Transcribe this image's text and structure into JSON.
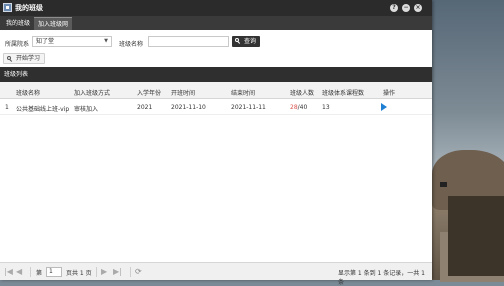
{
  "window": {
    "title": "我的班级",
    "controls": [
      "?",
      "−",
      "×"
    ]
  },
  "tabs": [
    {
      "label": "我的班级",
      "active": false
    },
    {
      "label": "加入班级网",
      "active": true
    }
  ],
  "filters": {
    "department_label": "所属院系",
    "department_value": "知了堂",
    "class_name_label": "班级名称",
    "class_name_value": "",
    "search_button": "查询",
    "start_study_button": "开始学习"
  },
  "section": {
    "title": "班级列表"
  },
  "table": {
    "columns": [
      "班级名称",
      "加入班级方式",
      "入学年份",
      "开班时间",
      "结束时间",
      "班级人数",
      "班级体系课程数",
      "操作"
    ],
    "rows": [
      {
        "index": "1",
        "name": "公共基础线上班-vip",
        "join_method": "审核加入",
        "year": "2021",
        "start": "2021-11-10",
        "end": "2021-11-11",
        "count_current": "28",
        "count_total": "/40",
        "courses": "13",
        "action_icon": "play-icon"
      }
    ]
  },
  "pager": {
    "page_prefix": "第",
    "page_value": "1",
    "page_suffix": "页共 1 页",
    "summary": "显示第 1 条到 1 条记录，一共 1 条"
  },
  "colors": {
    "titlebar": "#2b2b2b",
    "section_head": "#2f2f2f",
    "accent": "#1e7fd3",
    "count_highlight": "#d9534f"
  }
}
